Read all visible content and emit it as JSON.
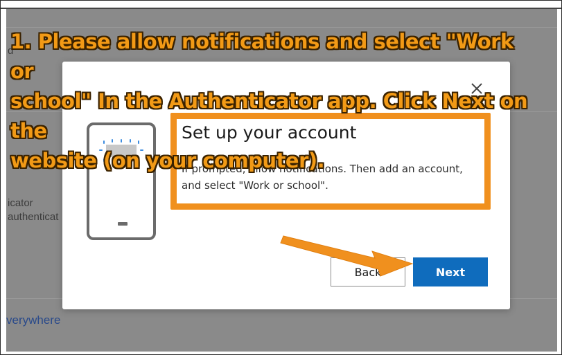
{
  "caption": {
    "line1": "1. Please allow notifications and select \"Work or",
    "line2": "school\" In the Authenticator app. Click Next on the",
    "line3": "website (on your computer)."
  },
  "background": {
    "fragment_top": "d",
    "fragment_r": "r",
    "method_line1": "icator",
    "method_line2": "authenticat",
    "link": "verywhere"
  },
  "dialog": {
    "title": "Set up your account",
    "description": "If prompted, allow notifications. Then add an account, and select \"Work or school\".",
    "back_label": "Back",
    "next_label": "Next",
    "close_icon": "close-icon"
  },
  "colors": {
    "annotation_orange": "#f0901e",
    "primary_blue": "#0f6cbd",
    "phone_gray": "#6b6b6b"
  }
}
